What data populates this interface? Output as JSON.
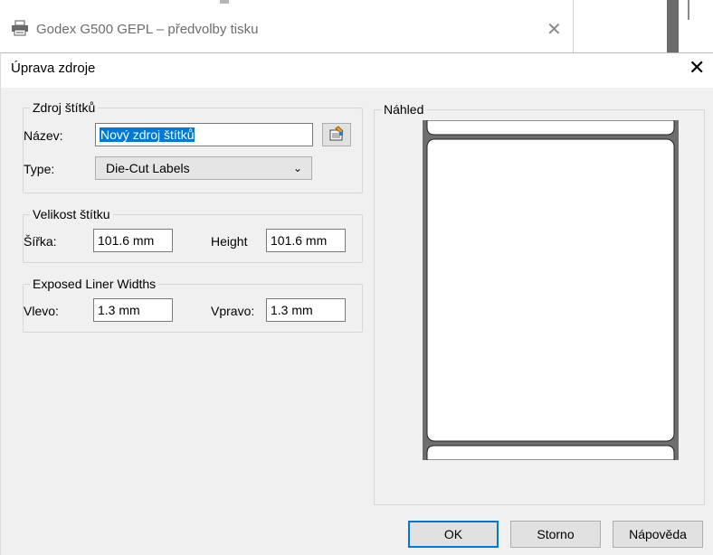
{
  "background_window": {
    "title": "Godex G500 GEPL – předvolby tisku",
    "close_glyph": "✕"
  },
  "dialog": {
    "title": "Úprava zdroje",
    "close_glyph": "✕",
    "source_group": {
      "legend": "Zdroj štítků",
      "name_label": "Název:",
      "name_value": "Nový zdroj štítků",
      "type_label": "Type:",
      "type_value": "Die-Cut Labels",
      "type_chevron": "⌄"
    },
    "size_group": {
      "legend": "Velikost štítku",
      "width_label": "Šířka:",
      "width_value": "101.6 mm",
      "height_label": "Height",
      "height_value": "101.6 mm"
    },
    "liner_group": {
      "legend": "Exposed Liner Widths",
      "left_label": "Vlevo:",
      "left_value": "1.3 mm",
      "right_label": "Vpravo:",
      "right_value": "1.3 mm"
    },
    "preview_group": {
      "legend": "Náhled"
    },
    "buttons": {
      "ok": "OK",
      "cancel": "Storno",
      "help": "Nápověda"
    }
  },
  "icons": [
    "printer-icon",
    "close-icon",
    "chevron-down-icon",
    "browse-icon"
  ]
}
